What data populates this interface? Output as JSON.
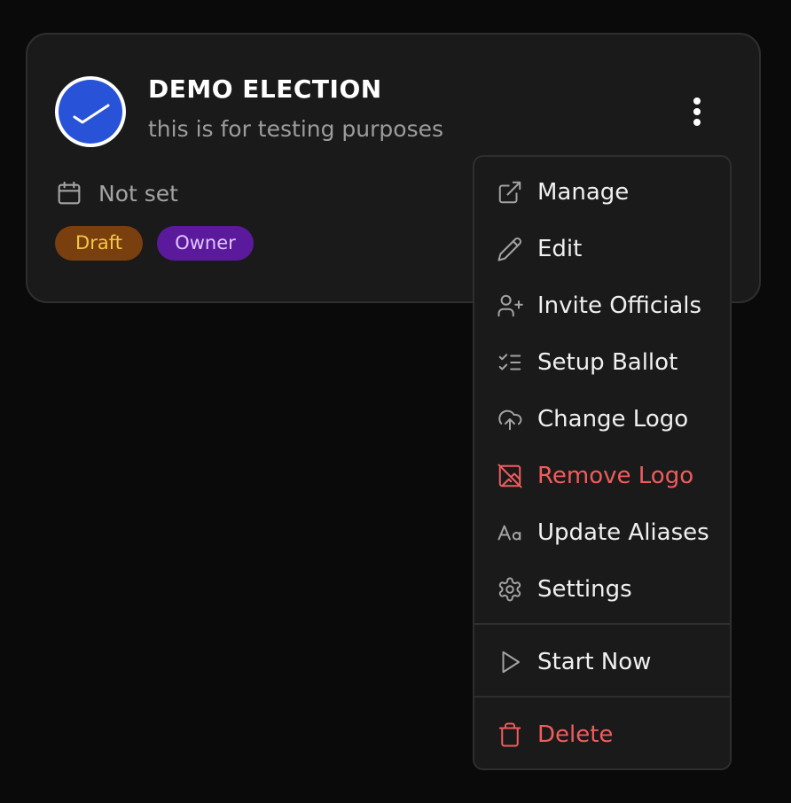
{
  "election": {
    "title": "DEMO ELECTION",
    "description": "this is for testing purposes",
    "date_text": "Not set",
    "badges": {
      "draft": "Draft",
      "owner": "Owner"
    }
  },
  "icons": {
    "logo": "checkmark-logo",
    "more": "more-vertical-icon",
    "date": "calendar-icon"
  },
  "menu": {
    "items": [
      {
        "label": "Manage",
        "icon": "external-link-icon",
        "danger": false
      },
      {
        "label": "Edit",
        "icon": "pencil-icon",
        "danger": false
      },
      {
        "label": "Invite Officials",
        "icon": "user-plus-icon",
        "danger": false
      },
      {
        "label": "Setup Ballot",
        "icon": "list-checks-icon",
        "danger": false
      },
      {
        "label": "Change Logo",
        "icon": "cloud-upload-icon",
        "danger": false
      },
      {
        "label": "Remove Logo",
        "icon": "image-off-icon",
        "danger": true
      },
      {
        "label": "Update Aliases",
        "icon": "type-aa-icon",
        "danger": false
      },
      {
        "label": "Settings",
        "icon": "gear-icon",
        "danger": false
      }
    ],
    "start_now": {
      "label": "Start Now",
      "icon": "play-icon",
      "danger": false
    },
    "delete": {
      "label": "Delete",
      "icon": "trash-icon",
      "danger": true
    }
  },
  "colors": {
    "background": "#0a0a0a",
    "card": "#1a1a1a",
    "border": "#2e2e2e",
    "logo_blue": "#2853d8",
    "danger": "#f05c5c",
    "draft_bg": "#7a3f0e",
    "draft_text": "#f6c744",
    "owner_bg": "#5b1a9c",
    "owner_text": "#e2c4ff"
  }
}
